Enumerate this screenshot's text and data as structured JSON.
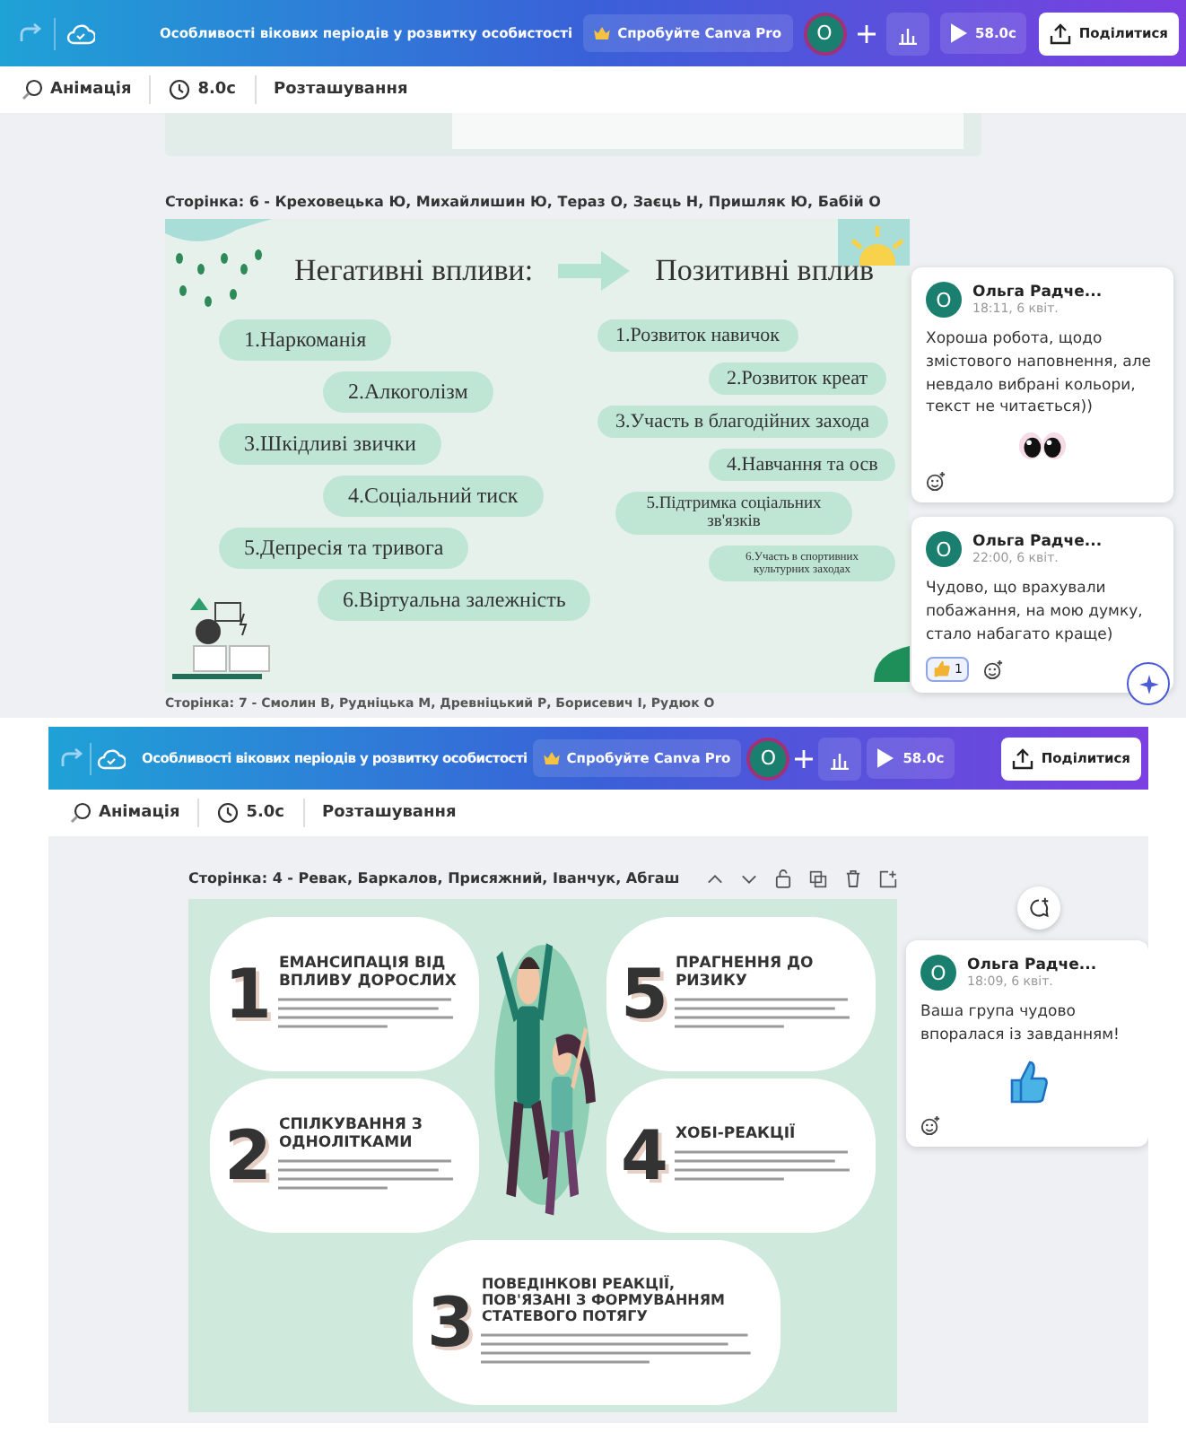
{
  "screens": [
    {
      "title": "Особливості вікових періодів у розвитку особистості",
      "pro_label": "Спробуйте Canva Pro",
      "avatar": "О",
      "duration": "58.0с",
      "share": "Поділитися",
      "animation": "Анімація",
      "timer": "8.0с",
      "arrange": "Розташування",
      "page_title": "Сторінка: 6 - Креховецька Ю, Михайлишин Ю, Тераз О, Заєць Н, Пришляк Ю, Бабій О",
      "slide": {
        "kind": "influences",
        "left_heading": "Негативні впливи:",
        "right_heading": "Позитивні вплив",
        "left_items": [
          "1.Наркоманія",
          "2.Алкоголізм",
          "3.Шкідливі звички",
          "4.Соціальний тиск",
          "5.Депресія та тривога",
          "6.Віртуальна залежність"
        ],
        "right_items": [
          "1.Розвиток навичок",
          "2.Розвиток креат",
          "3.Участь в благодійних захода",
          "4.Навчання та осв",
          "5.Підтримка соціальних зв'язків",
          "6.Участь в спортивних культурних заходах"
        ]
      },
      "comments": [
        {
          "author": "Ольга Радче...",
          "avatar": "О",
          "time": "18:11, 6 квіт.",
          "text": "Хороша робота, щодо змістового наповнення, але невдало вибрані кольори, текст не читається))",
          "sticker": {
            "kind": "eyes"
          }
        },
        {
          "author": "Ольга Радче...",
          "avatar": "О",
          "time": "22:00, 6 квіт.",
          "text": "Чудово, що врахували побажання, на мою думку, стало набагато краще)",
          "reactions": [
            {
              "kind": "thumbs",
              "count": "1"
            }
          ]
        }
      ],
      "next_page_title": "Сторінка: 7 - Смолин В, Рудніцька М, Древніцький Р, Борисевич І, Рудюк О"
    },
    {
      "title": "Особливості вікових періодів у розвитку особистості",
      "pro_label": "Спробуйте Canva Pro",
      "avatar": "О",
      "duration": "58.0с",
      "share": "Поділитися",
      "animation": "Анімація",
      "timer": "5.0с",
      "arrange": "Розташування",
      "page_title": "Сторінка: 4 - Ревак, Баркалов, Присяжний, Іванчук, Абгаш",
      "slide": {
        "kind": "infographic",
        "sections": [
          {
            "number": "1",
            "heading": "ЕМАНСИПАЦІЯ ВІД ВПЛИВУ ДОРОСЛИХ"
          },
          {
            "number": "5",
            "heading": "ПРАГНЕННЯ ДО РИЗИКУ"
          },
          {
            "number": "2",
            "heading": "СПІЛКУВАННЯ З ОДНОЛІТКАМИ"
          },
          {
            "number": "4",
            "heading": "ХОБІ-РЕАКЦІЇ"
          },
          {
            "number": "3",
            "heading": "ПОВЕДІНКОВІ РЕАКЦІЇ, ПОВ'ЯЗАНІ З ФОРМУВАННЯМ СТАТЕВОГО ПОТЯГУ"
          }
        ]
      },
      "comments": [
        {
          "author": "Ольга Радче...",
          "avatar": "О",
          "time": "18:09, 6 квіт.",
          "text": "Ваша група чудово впоралася із завданням!",
          "sticker": {
            "kind": "thumbs"
          }
        }
      ]
    }
  ]
}
